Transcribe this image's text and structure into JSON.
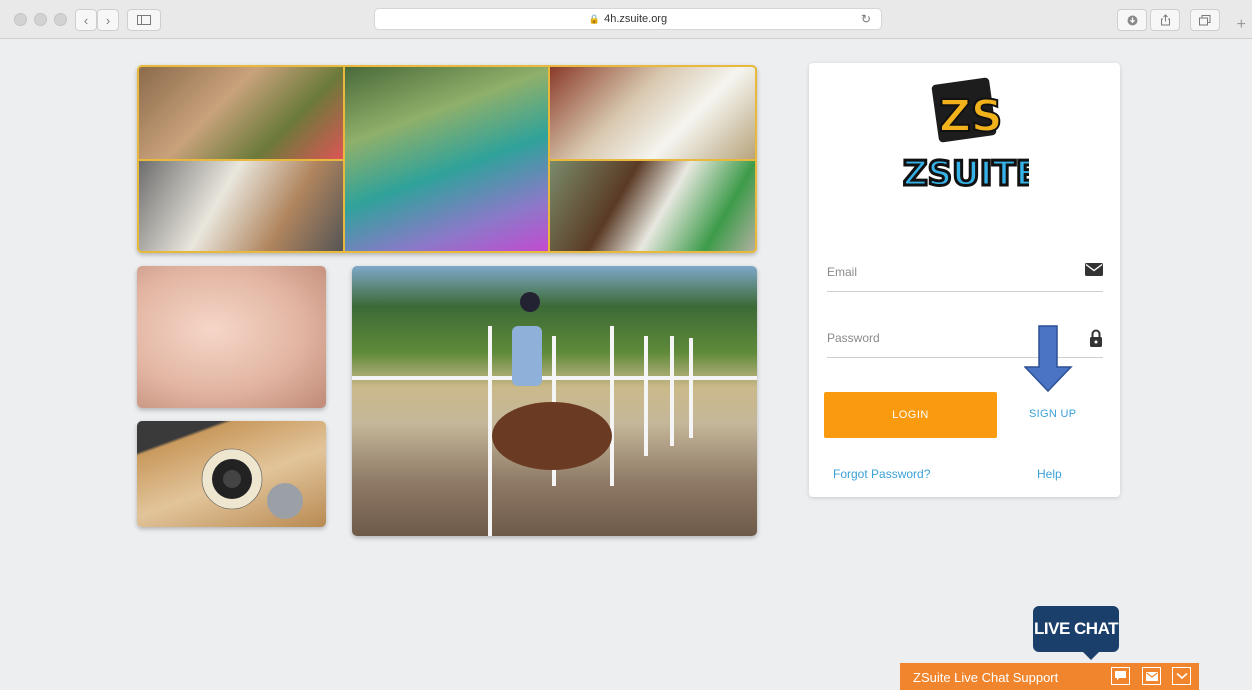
{
  "browser": {
    "url": "4h.zsuite.org"
  },
  "brand": {
    "logo_top": "ZS",
    "logo_bottom": "ZSUITE"
  },
  "login": {
    "email_placeholder": "Email",
    "password_placeholder": "Password",
    "login_label": "LOGIN",
    "signup_label": "SIGN UP",
    "forgot_label": "Forgot Password?",
    "help_label": "Help"
  },
  "chat": {
    "bubble_label": "LIVE CHAT",
    "bar_title": "ZSuite Live Chat Support"
  },
  "colors": {
    "accent_orange": "#f99a0f",
    "link_blue": "#3aa0d8",
    "chat_navy": "#1b3f6b",
    "chat_bar": "#f0852d",
    "collage_border": "#e8b93c"
  }
}
